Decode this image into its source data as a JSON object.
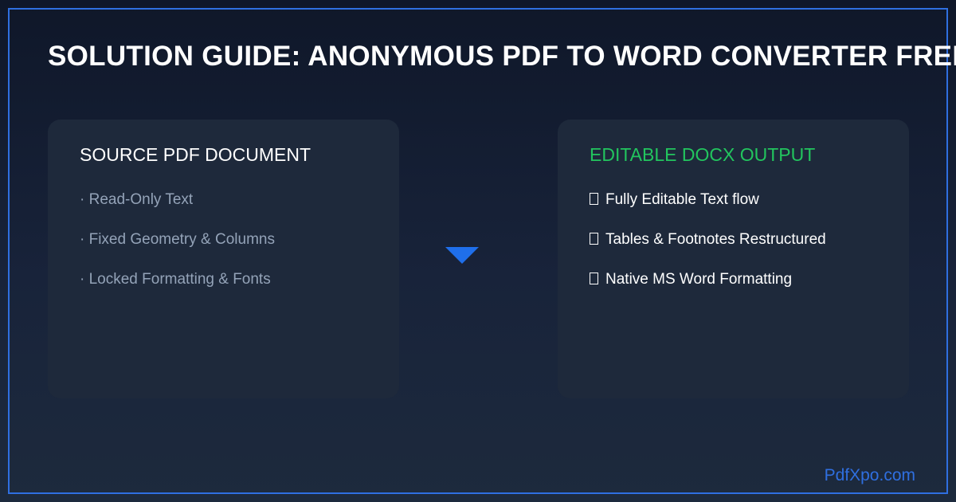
{
  "title": "SOLUTION GUIDE: ANONYMOUS PDF TO WORD CONVERTER FREE",
  "source_card": {
    "title": "SOURCE PDF DOCUMENT",
    "bullet": "·",
    "items": [
      "Read-Only Text",
      "Fixed Geometry & Columns",
      "Locked Formatting & Fonts"
    ]
  },
  "output_card": {
    "title": "EDITABLE DOCX OUTPUT",
    "items": [
      "Fully Editable Text flow",
      "Tables & Footnotes Restructured",
      "Native MS Word Formatting"
    ]
  },
  "brand": "PdfXpo.com",
  "colors": {
    "accent": "#2f6fe0",
    "arrow": "#1f6feb",
    "success": "#22c55e",
    "muted_text": "#94a3b8",
    "card_bg": "#1e293b"
  },
  "icons": {
    "arrow": "triangle-down-icon",
    "check": "checkbox-glyph-icon"
  }
}
